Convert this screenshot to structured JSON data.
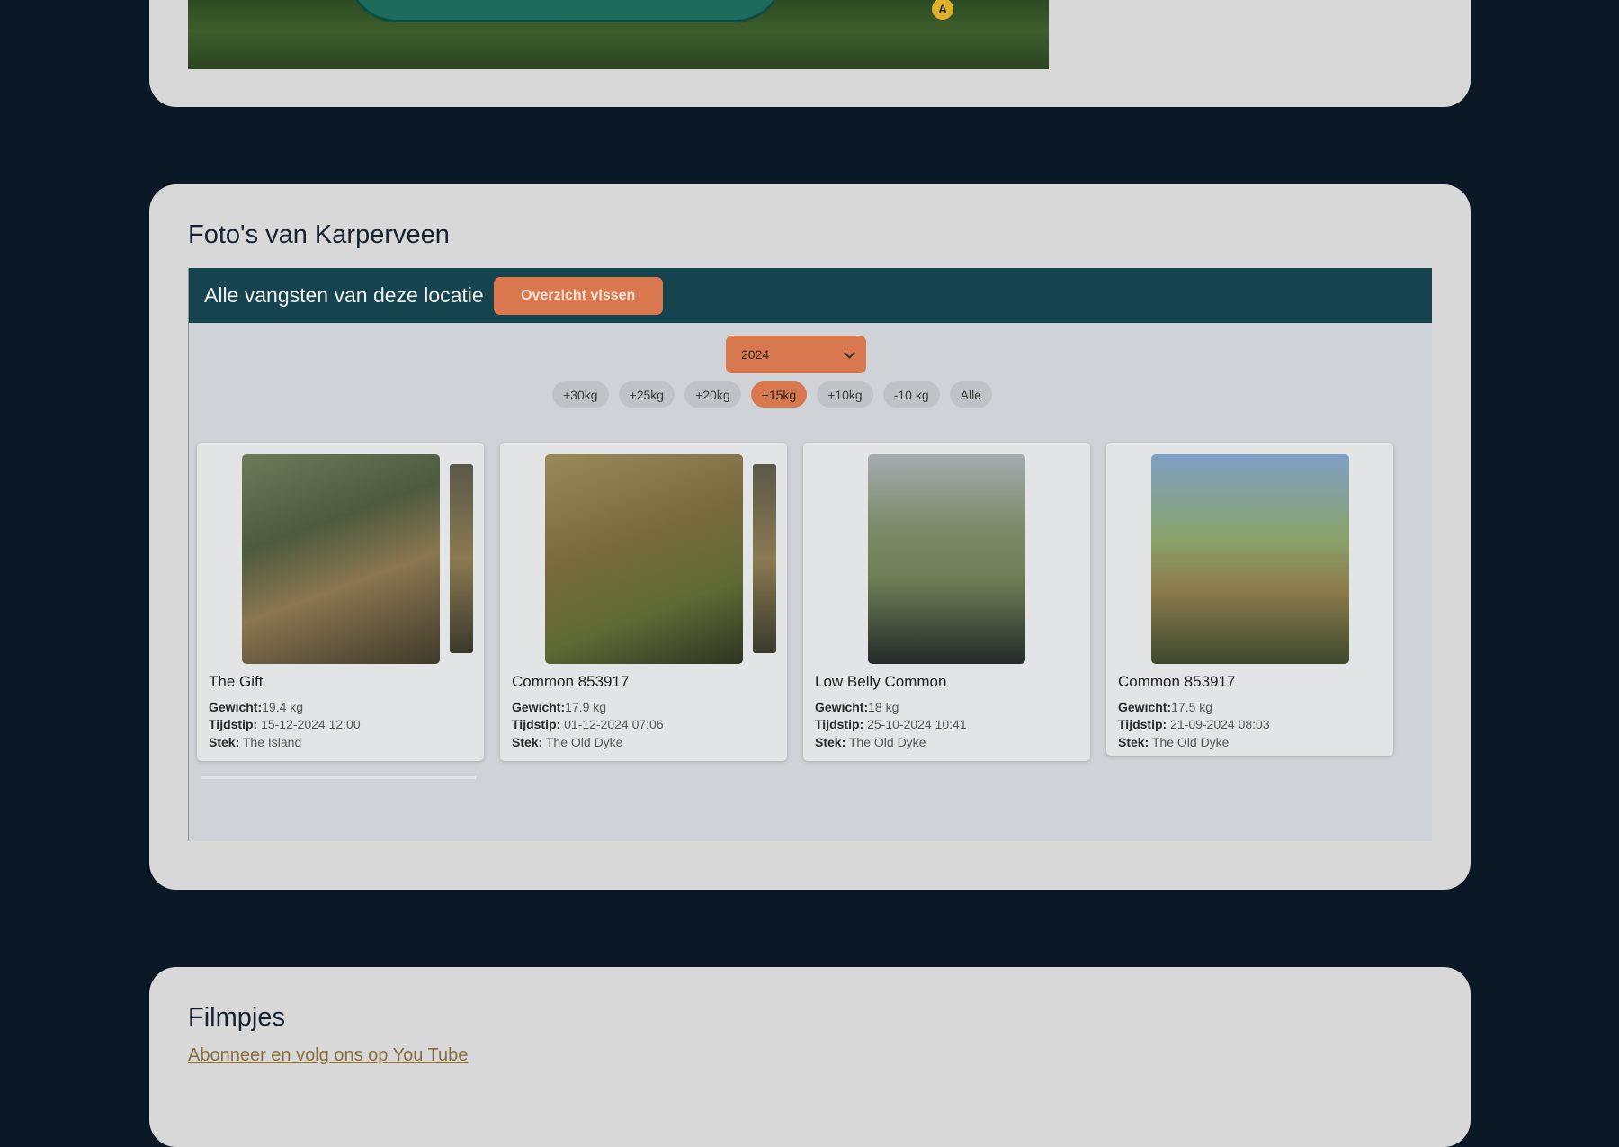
{
  "banner": {
    "marker": "A"
  },
  "photos_section": {
    "title": "Foto's van Karperveen",
    "header_title": "Alle vangsten van deze locatie",
    "overview_button": "Overzicht vissen",
    "year_selected": "2024",
    "filters": [
      "+30kg",
      "+25kg",
      "+20kg",
      "+15kg",
      "+10kg",
      "-10 kg",
      "Alle"
    ],
    "active_filter": "+15kg",
    "catches": [
      {
        "name": "The Gift",
        "weight": "19.4 kg",
        "time": "15-12-2024 12:00",
        "spot": "The Island"
      },
      {
        "name": "Common 853917",
        "weight": "17.9 kg",
        "time": "01-12-2024 07:06",
        "spot": "The Old Dyke"
      },
      {
        "name": "Low Belly Common",
        "weight": "18 kg",
        "time": "25-10-2024 10:41",
        "spot": "The Old Dyke"
      },
      {
        "name": "Common 853917",
        "weight": "17.5 kg",
        "time": "21-09-2024 08:03",
        "spot": "The Old Dyke"
      }
    ],
    "labels": {
      "weight": "Gewicht:",
      "time": "Tijdstip:",
      "spot": "Stek:"
    }
  },
  "films_section": {
    "title": "Filmpjes",
    "youtube_link": "Abonneer en volg ons op You Tube"
  },
  "colors": {
    "accent": "#d9784e",
    "header": "#16444e",
    "background": "#0b1826",
    "card": "#d8d8d8"
  }
}
